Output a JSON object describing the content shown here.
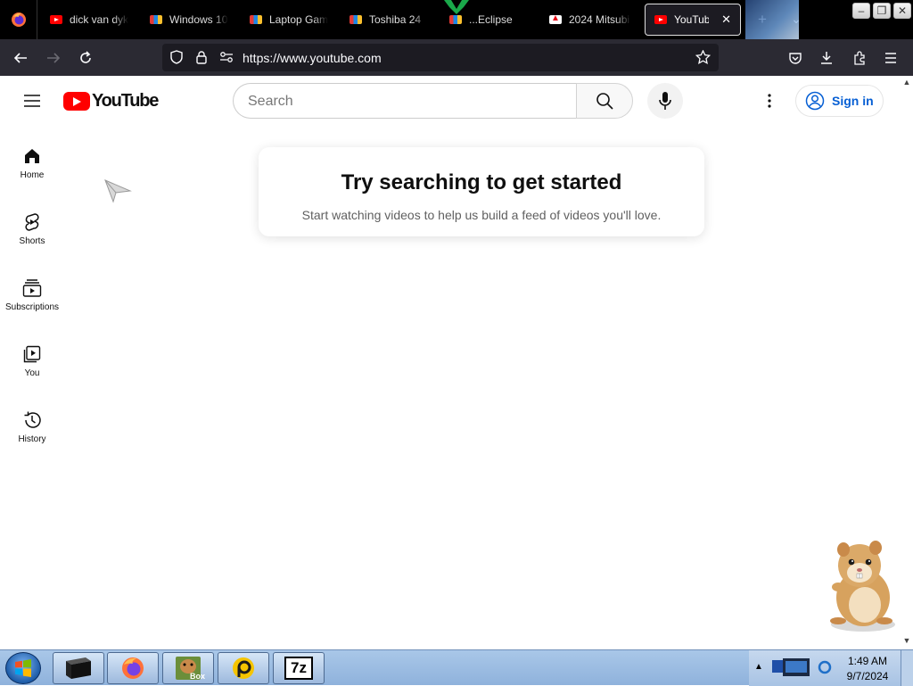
{
  "browser": {
    "tabs": [
      {
        "label": "dick van dyke",
        "favicon": "youtube-favicon",
        "active": false
      },
      {
        "label": "Windows 10 ",
        "favicon": "colorbars-favicon",
        "active": false
      },
      {
        "label": "Laptop Gami",
        "favicon": "colorbars-favicon",
        "active": false
      },
      {
        "label": "Toshiba 24",
        "favicon": "colorbars-favicon",
        "active": false
      },
      {
        "label": "...Eclipse",
        "favicon": "colorbars-favicon",
        "active": false
      },
      {
        "label": "2024 Mitsubi",
        "favicon": "mitsubishi-favicon",
        "active": false
      },
      {
        "label": "YouTube",
        "favicon": "youtube-favicon",
        "active": true
      }
    ],
    "url": "https://www.youtube.com"
  },
  "youtube": {
    "logo_text": "YouTube",
    "search_placeholder": "Search",
    "sign_in": "Sign in",
    "guide": [
      {
        "label": "Home",
        "icon": "home-icon"
      },
      {
        "label": "Shorts",
        "icon": "shorts-icon"
      },
      {
        "label": "Subscriptions",
        "icon": "subscriptions-icon"
      },
      {
        "label": "You",
        "icon": "you-icon"
      },
      {
        "label": "History",
        "icon": "history-icon"
      }
    ],
    "empty_state": {
      "title": "Try searching to get started",
      "subtitle": "Start watching videos to help us build a feed of videos you'll love."
    },
    "colors": {
      "brand_red": "#ff0000",
      "link_blue": "#065fd4"
    }
  },
  "taskbar": {
    "apps": [
      "file-explorer-icon",
      "firefox-icon",
      "sandbox-icon",
      "app-icon",
      "7zip-icon"
    ],
    "seven_zip_label": "7z",
    "box_label": "Box",
    "clock_time": "1:49 AM",
    "clock_date": "9/7/2024"
  }
}
